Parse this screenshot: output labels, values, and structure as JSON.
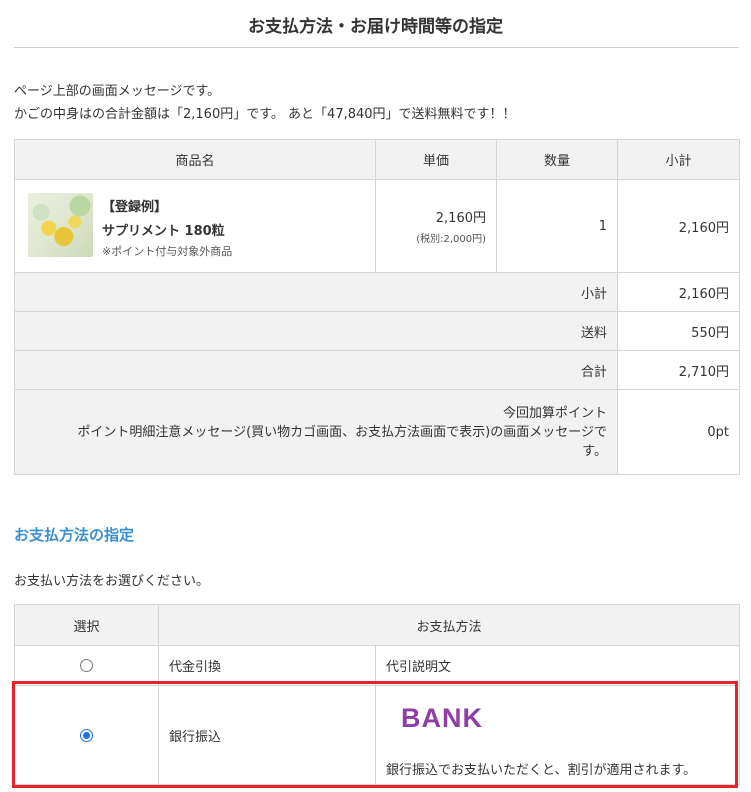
{
  "page": {
    "title": "お支払方法・お届け時間等の指定",
    "message_line1": "ページ上部の画面メッセージです。",
    "message_line2": "かごの中身はの合計金額は「2,160円」です。 あと「47,840円」で送料無料です！！"
  },
  "cart": {
    "headers": [
      "商品名",
      "単価",
      "数量",
      "小計"
    ],
    "item": {
      "tag": "【登録例】",
      "name": "サプリメント 180粒",
      "note": "※ポイント付与対象外商品",
      "price": "2,160円",
      "price_excl_tax": "(税別:2,000円)",
      "quantity": "1",
      "subtotal": "2,160円"
    },
    "summary": {
      "subtotal_label": "小計",
      "subtotal_value": "2,160円",
      "shipping_label": "送料",
      "shipping_value": "550円",
      "total_label": "合計",
      "total_value": "2,710円",
      "points_label_line1": "今回加算ポイント",
      "points_label_line2": "ポイント明細注意メッセージ(買い物カゴ画面、お支払方法画面で表示)の画面メッセージで",
      "points_label_line3": "す。",
      "points_value": "0pt"
    }
  },
  "payment": {
    "section_title": "お支払方法の指定",
    "lead": "お支払い方法をお選びください。",
    "headers": [
      "選択",
      "お支払方法"
    ],
    "methods": [
      {
        "name": "代金引換",
        "description": "代引説明文",
        "selected": false
      },
      {
        "name": "銀行振込",
        "logo_text": "BANK",
        "description": "銀行振込でお支払いただくと、割引が適用されます。",
        "selected": true
      }
    ]
  },
  "colors": {
    "section_title": "#3a8fd1",
    "highlight_border": "#e8212b",
    "bank_logo": "#8e3ea6",
    "radio_selected": "#1a73e8",
    "header_bg": "#f2f2f2"
  }
}
